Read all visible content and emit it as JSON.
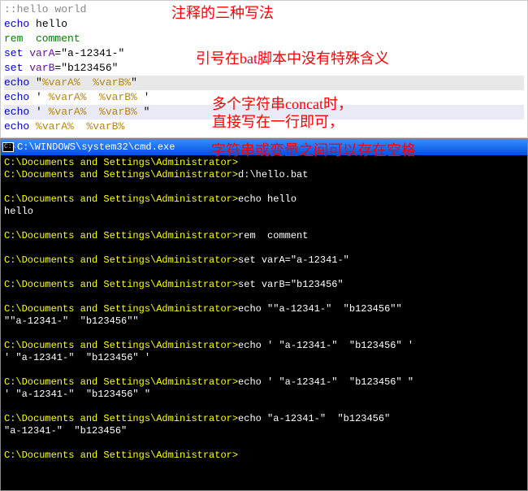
{
  "editor": {
    "lines": [
      {
        "parts": [
          {
            "t": "::hello world",
            "cls": "gray"
          }
        ],
        "hl": ""
      },
      {
        "parts": [
          {
            "t": "echo",
            "cls": "blue"
          },
          {
            "t": " hello",
            "cls": ""
          }
        ],
        "hl": ""
      },
      {
        "parts": [
          {
            "t": "rem",
            "cls": "green"
          },
          {
            "t": "  comment",
            "cls": "green"
          }
        ],
        "hl": ""
      },
      {
        "parts": [
          {
            "t": "set",
            "cls": "blue"
          },
          {
            "t": " varA",
            "cls": "dpurple"
          },
          {
            "t": "=",
            "cls": ""
          },
          {
            "t": "\"a-12341-\"",
            "cls": ""
          }
        ],
        "hl": ""
      },
      {
        "parts": [
          {
            "t": "set",
            "cls": "blue"
          },
          {
            "t": " varB",
            "cls": "dpurple"
          },
          {
            "t": "=",
            "cls": ""
          },
          {
            "t": "\"b123456\"",
            "cls": ""
          }
        ],
        "hl": ""
      },
      {
        "parts": [
          {
            "t": "echo",
            "cls": "blue"
          },
          {
            "t": " \"",
            "cls": ""
          },
          {
            "t": "%varA%",
            "cls": "orange"
          },
          {
            "t": "  ",
            "cls": ""
          },
          {
            "t": "%varB%",
            "cls": "orange"
          },
          {
            "t": "\"",
            "cls": ""
          }
        ],
        "hl": "hl1"
      },
      {
        "parts": [
          {
            "t": "echo",
            "cls": "blue"
          },
          {
            "t": " ' ",
            "cls": ""
          },
          {
            "t": "%varA%",
            "cls": "orange"
          },
          {
            "t": "  ",
            "cls": ""
          },
          {
            "t": "%varB%",
            "cls": "orange"
          },
          {
            "t": " '",
            "cls": ""
          }
        ],
        "hl": ""
      },
      {
        "parts": [
          {
            "t": "echo",
            "cls": "blue"
          },
          {
            "t": " ' ",
            "cls": ""
          },
          {
            "t": "%varA%",
            "cls": "orange"
          },
          {
            "t": "  ",
            "cls": ""
          },
          {
            "t": "%varB%",
            "cls": "orange"
          },
          {
            "t": " \"",
            "cls": ""
          }
        ],
        "hl": "hl2"
      },
      {
        "parts": [
          {
            "t": "echo",
            "cls": "blue"
          },
          {
            "t": " ",
            "cls": ""
          },
          {
            "t": "%varA%",
            "cls": "orange"
          },
          {
            "t": "  ",
            "cls": ""
          },
          {
            "t": "%varB%",
            "cls": "orange"
          }
        ],
        "hl": ""
      }
    ],
    "annotations": {
      "a1": "注释的三种写法",
      "a2": "引号在bat脚本中没有特殊含义",
      "a3": "多个字符串concat时，",
      "a4": "直接写在一行即可，",
      "a5": "字符串或变量之间可以存在空格"
    }
  },
  "terminal": {
    "title": "C:\\WINDOWS\\system32\\cmd.exe",
    "icon_label": "C:\\",
    "lines": [
      {
        "p": "C:\\Documents and Settings\\Administrator>",
        "c": ""
      },
      {
        "p": "C:\\Documents and Settings\\Administrator>",
        "c": "d:\\hello.bat"
      },
      {
        "p": "",
        "c": ""
      },
      {
        "p": "C:\\Documents and Settings\\Administrator>",
        "c": "echo hello"
      },
      {
        "p": "hello",
        "c": "",
        "plain": true
      },
      {
        "p": "",
        "c": ""
      },
      {
        "p": "C:\\Documents and Settings\\Administrator>",
        "c": "rem  comment"
      },
      {
        "p": "",
        "c": ""
      },
      {
        "p": "C:\\Documents and Settings\\Administrator>",
        "c": "set varA=\"a-12341-\""
      },
      {
        "p": "",
        "c": ""
      },
      {
        "p": "C:\\Documents and Settings\\Administrator>",
        "c": "set varB=\"b123456\""
      },
      {
        "p": "",
        "c": ""
      },
      {
        "p": "C:\\Documents and Settings\\Administrator>",
        "c": "echo \"\"a-12341-\"  \"b123456\"\""
      },
      {
        "p": "\"\"a-12341-\"  \"b123456\"\"",
        "c": "",
        "plain": true
      },
      {
        "p": "",
        "c": ""
      },
      {
        "p": "C:\\Documents and Settings\\Administrator>",
        "c": "echo ' \"a-12341-\"  \"b123456\" '"
      },
      {
        "p": "' \"a-12341-\"  \"b123456\" '",
        "c": "",
        "plain": true
      },
      {
        "p": "",
        "c": ""
      },
      {
        "p": "C:\\Documents and Settings\\Administrator>",
        "c": "echo ' \"a-12341-\"  \"b123456\" \""
      },
      {
        "p": "' \"a-12341-\"  \"b123456\" \"",
        "c": "",
        "plain": true
      },
      {
        "p": "",
        "c": ""
      },
      {
        "p": "C:\\Documents and Settings\\Administrator>",
        "c": "echo \"a-12341-\"  \"b123456\""
      },
      {
        "p": "\"a-12341-\"  \"b123456\"",
        "c": "",
        "plain": true
      },
      {
        "p": "",
        "c": ""
      },
      {
        "p": "C:\\Documents and Settings\\Administrator>",
        "c": ""
      }
    ]
  }
}
